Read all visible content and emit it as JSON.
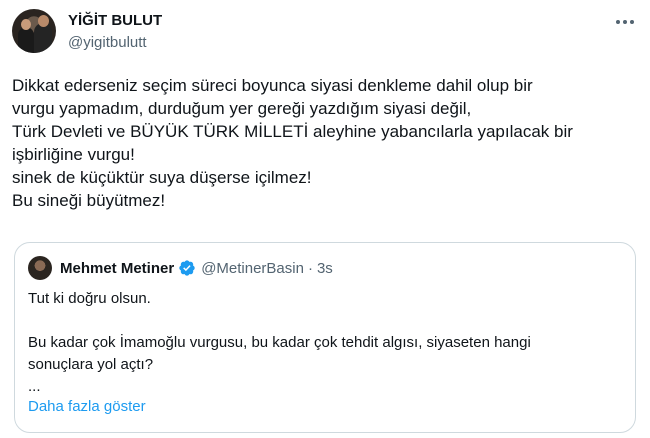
{
  "author": {
    "display_name": "YİĞİT BULUT",
    "handle": "@yigitbulutt"
  },
  "tweet": {
    "lines": [
      "Dikkat ederseniz seçim süreci boyunca siyasi denkleme dahil olup bir",
      "vurgu yapmadım, durduğum yer gereği yazdığım siyasi değil,",
      "Türk Devleti ve BÜYÜK TÜRK MİLLETİ aleyhine yabancılarla yapılacak bir",
      "işbirliğine vurgu!",
      "sinek de küçüktür suya düşerse içilmez!",
      "Bu sineği büyütmez!"
    ]
  },
  "quoted": {
    "display_name": "Mehmet Metiner",
    "handle": "@MetinerBasin",
    "separator": "·",
    "time": "3s",
    "verified_color": "#1d9bf0",
    "lines": [
      "Tut ki doğru olsun.",
      "",
      "Bu kadar çok İmamoğlu vurgusu, bu kadar çok tehdit algısı, siyaseten hangi",
      "sonuçlara yol açtı?",
      "..."
    ],
    "show_more": "Daha fazla göster"
  },
  "icons": {
    "more": "more-horizontal-icon",
    "verified": "verified-badge-icon"
  },
  "colors": {
    "text": "#0f1419",
    "secondary": "#536471",
    "link": "#1d9bf0",
    "border": "#cfd9de"
  }
}
